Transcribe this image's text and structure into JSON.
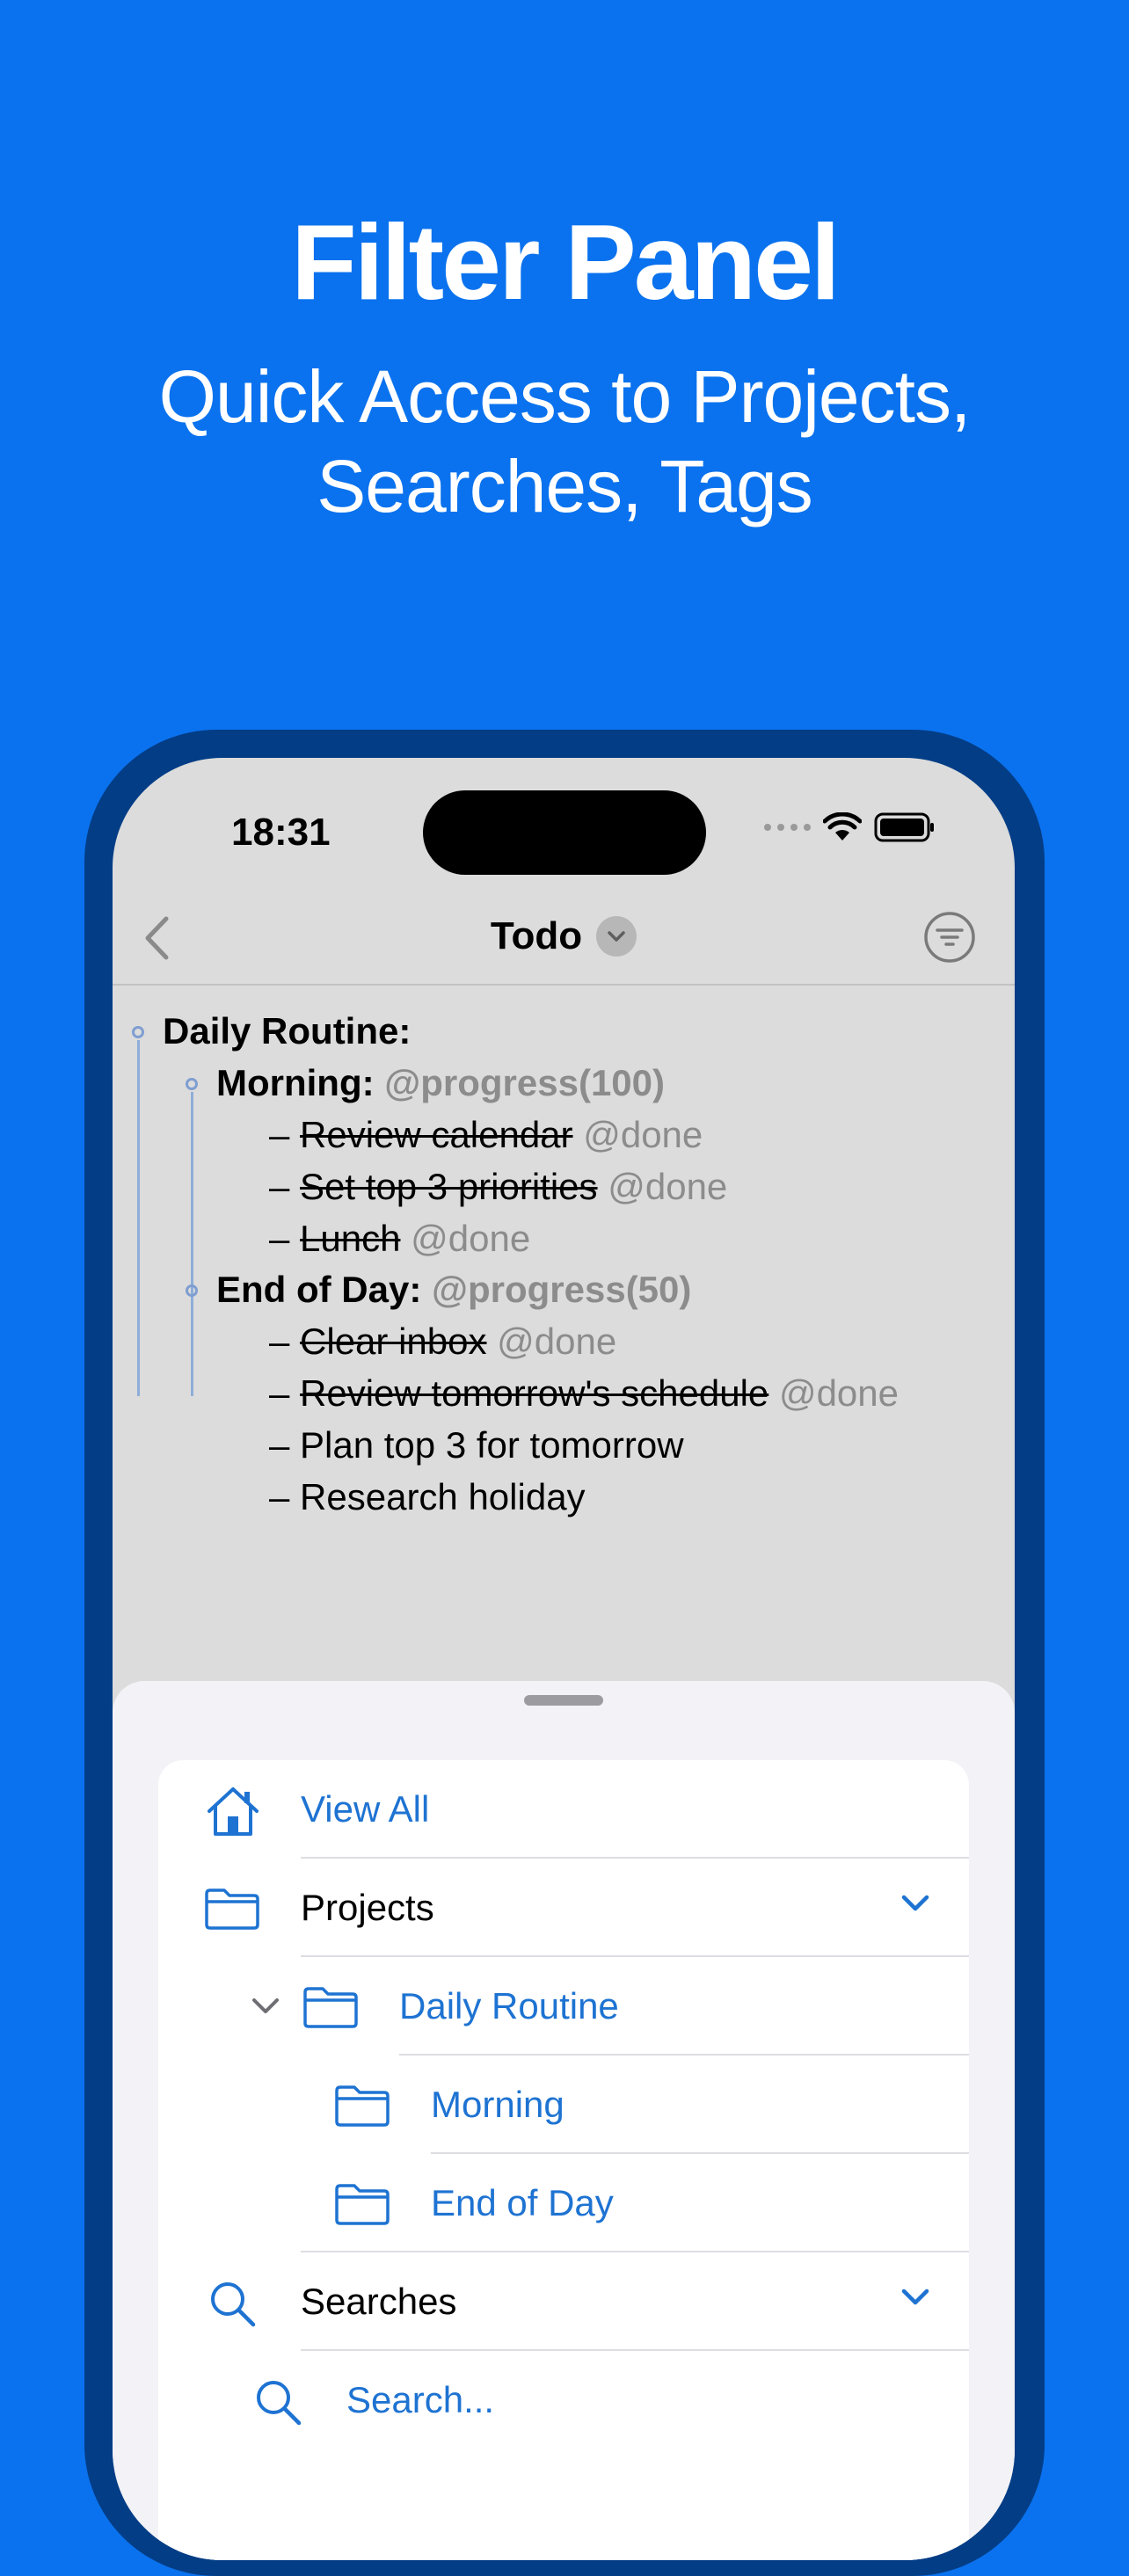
{
  "hero": {
    "title": "Filter Panel",
    "subtitle_line1": "Quick Access to Projects,",
    "subtitle_line2": "Searches, Tags"
  },
  "status_bar": {
    "time": "18:31"
  },
  "nav": {
    "title": "Todo"
  },
  "document": {
    "root": "Daily Routine:",
    "morning": {
      "title": "Morning:",
      "tag": "@progress(100)"
    },
    "morning_tasks": [
      {
        "dash": "– ",
        "text": "Review calendar",
        "tag": "@done"
      },
      {
        "dash": "– ",
        "text": "Set top 3 priorities",
        "tag": "@done"
      },
      {
        "dash": "– ",
        "text": "Lunch",
        "tag": "@done"
      }
    ],
    "eod": {
      "title": "End of Day:",
      "tag": "@progress(50)"
    },
    "eod_tasks": [
      {
        "dash": "– ",
        "text": "Clear inbox",
        "tag": "@done"
      },
      {
        "dash": "– ",
        "text": "Review tomorrow's schedule",
        "tag": "@done"
      },
      {
        "dash": "– ",
        "text": "Plan top 3 for tomorrow",
        "tag": ""
      },
      {
        "dash": "– ",
        "text": "Research holiday",
        "tag": ""
      }
    ]
  },
  "filter_panel": {
    "view_all": "View All",
    "projects": "Projects",
    "project_daily": "Daily Routine",
    "project_morning": "Morning",
    "project_eod": "End of Day",
    "searches": "Searches",
    "search_placeholder": "Search..."
  },
  "colors": {
    "background": "#0a72ee",
    "accent": "#1e73d2",
    "tag_gray": "#8c8c8c"
  },
  "icons": {
    "view_all": "house-icon",
    "projects": "folder-icon",
    "searches": "magnifier-icon"
  }
}
